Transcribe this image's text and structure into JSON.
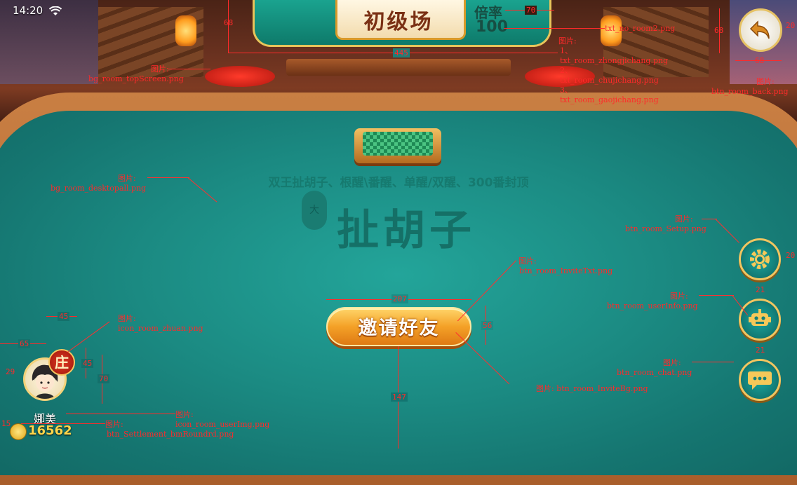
{
  "status_bar": {
    "time": "14:20"
  },
  "header": {
    "room_title": "初级场",
    "rate_label": "倍率",
    "rate_value": "100"
  },
  "table": {
    "rules_text": "双王扯胡子、根醒\\番醒、单醒/双醒、300番封顶",
    "game_logo": "扯胡子",
    "logo_seal": "大"
  },
  "invite_button": {
    "label": "邀请好友"
  },
  "player": {
    "name": "娜美",
    "badge": "庄",
    "coins": "16562"
  },
  "annotations": {
    "bg_top": [
      "图片:",
      "bg_room_topScreen.png"
    ],
    "txt_room": [
      "图片:",
      "1、",
      "txt_room_zhongjichang.png",
      "2、",
      "txt_room_chujichang.png",
      "3、",
      "txt_room_gaojichang.png"
    ],
    "txt_no": "txt_no_room2.png",
    "btn_back": [
      "图片:",
      "btn_room_back.png"
    ],
    "bg_desktop": [
      "图片:",
      "bg_room_desktopall.png"
    ],
    "btn_setup": [
      "图片:",
      "btn_room_Setup.png"
    ],
    "btn_invite_txt": [
      "图片:",
      "btn_room_InviteTxt.png"
    ],
    "btn_userinfo": [
      "图片:",
      "btn_room_userInfo.png"
    ],
    "icon_zhuan": [
      "图片:",
      "icon_room_zhuan.png"
    ],
    "btn_chat": [
      "图片:",
      "btn_room_chat.png"
    ],
    "btn_invite_bg": "图片: btn_room_InviteBg.png",
    "icon_userimg": [
      "图片:",
      "icon_room_userImg.png"
    ],
    "btn_settlement": [
      "图片:",
      "btn_Settlement_bmRoundrd.png"
    ]
  },
  "dimensions": {
    "d68a": "68",
    "d70": "70",
    "d445": "445",
    "d20a": "20",
    "d68b": "68",
    "d68c": "68",
    "d20b": "20",
    "d207": "207",
    "d21a": "21",
    "d56": "56",
    "d21b": "21",
    "d45a": "45",
    "d65": "65",
    "d45b": "45",
    "d29": "29",
    "d70b": "70",
    "d15": "15",
    "d147": "147"
  }
}
